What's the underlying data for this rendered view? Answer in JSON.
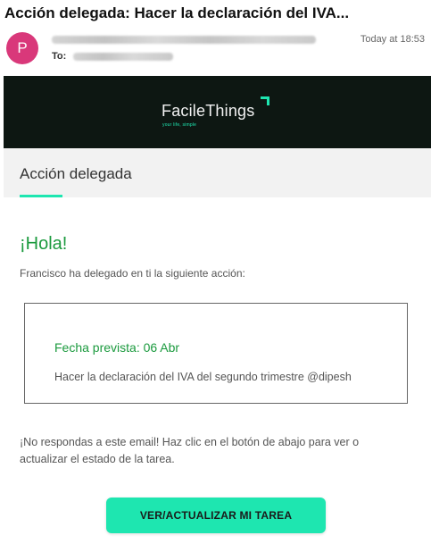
{
  "email": {
    "subject": "Acción delegada: Hacer la declaración del IVA...",
    "avatar_initial": "P",
    "to_label": "To:",
    "time": "Today at 18:53"
  },
  "brand": {
    "name": "FacileThings",
    "tagline": "your life, simple",
    "accent_color": "#1ee6b0",
    "banner_color": "#0d1712"
  },
  "section": {
    "title": "Acción delegada"
  },
  "body": {
    "greeting": "¡Hola!",
    "intro": "Francisco ha delegado en ti la siguiente acción:",
    "card": {
      "date": "Fecha prevista: 06 Abr",
      "description": "Hacer la declaración del IVA del segundo trimestre @dipesh"
    },
    "notice_line1": "¡No respondas a este email! Haz clic en el botón de abajo para ver o",
    "notice_line2": "actualizar el estado de la tarea."
  },
  "cta": {
    "label": "VER/ACTUALIZAR MI TAREA"
  }
}
